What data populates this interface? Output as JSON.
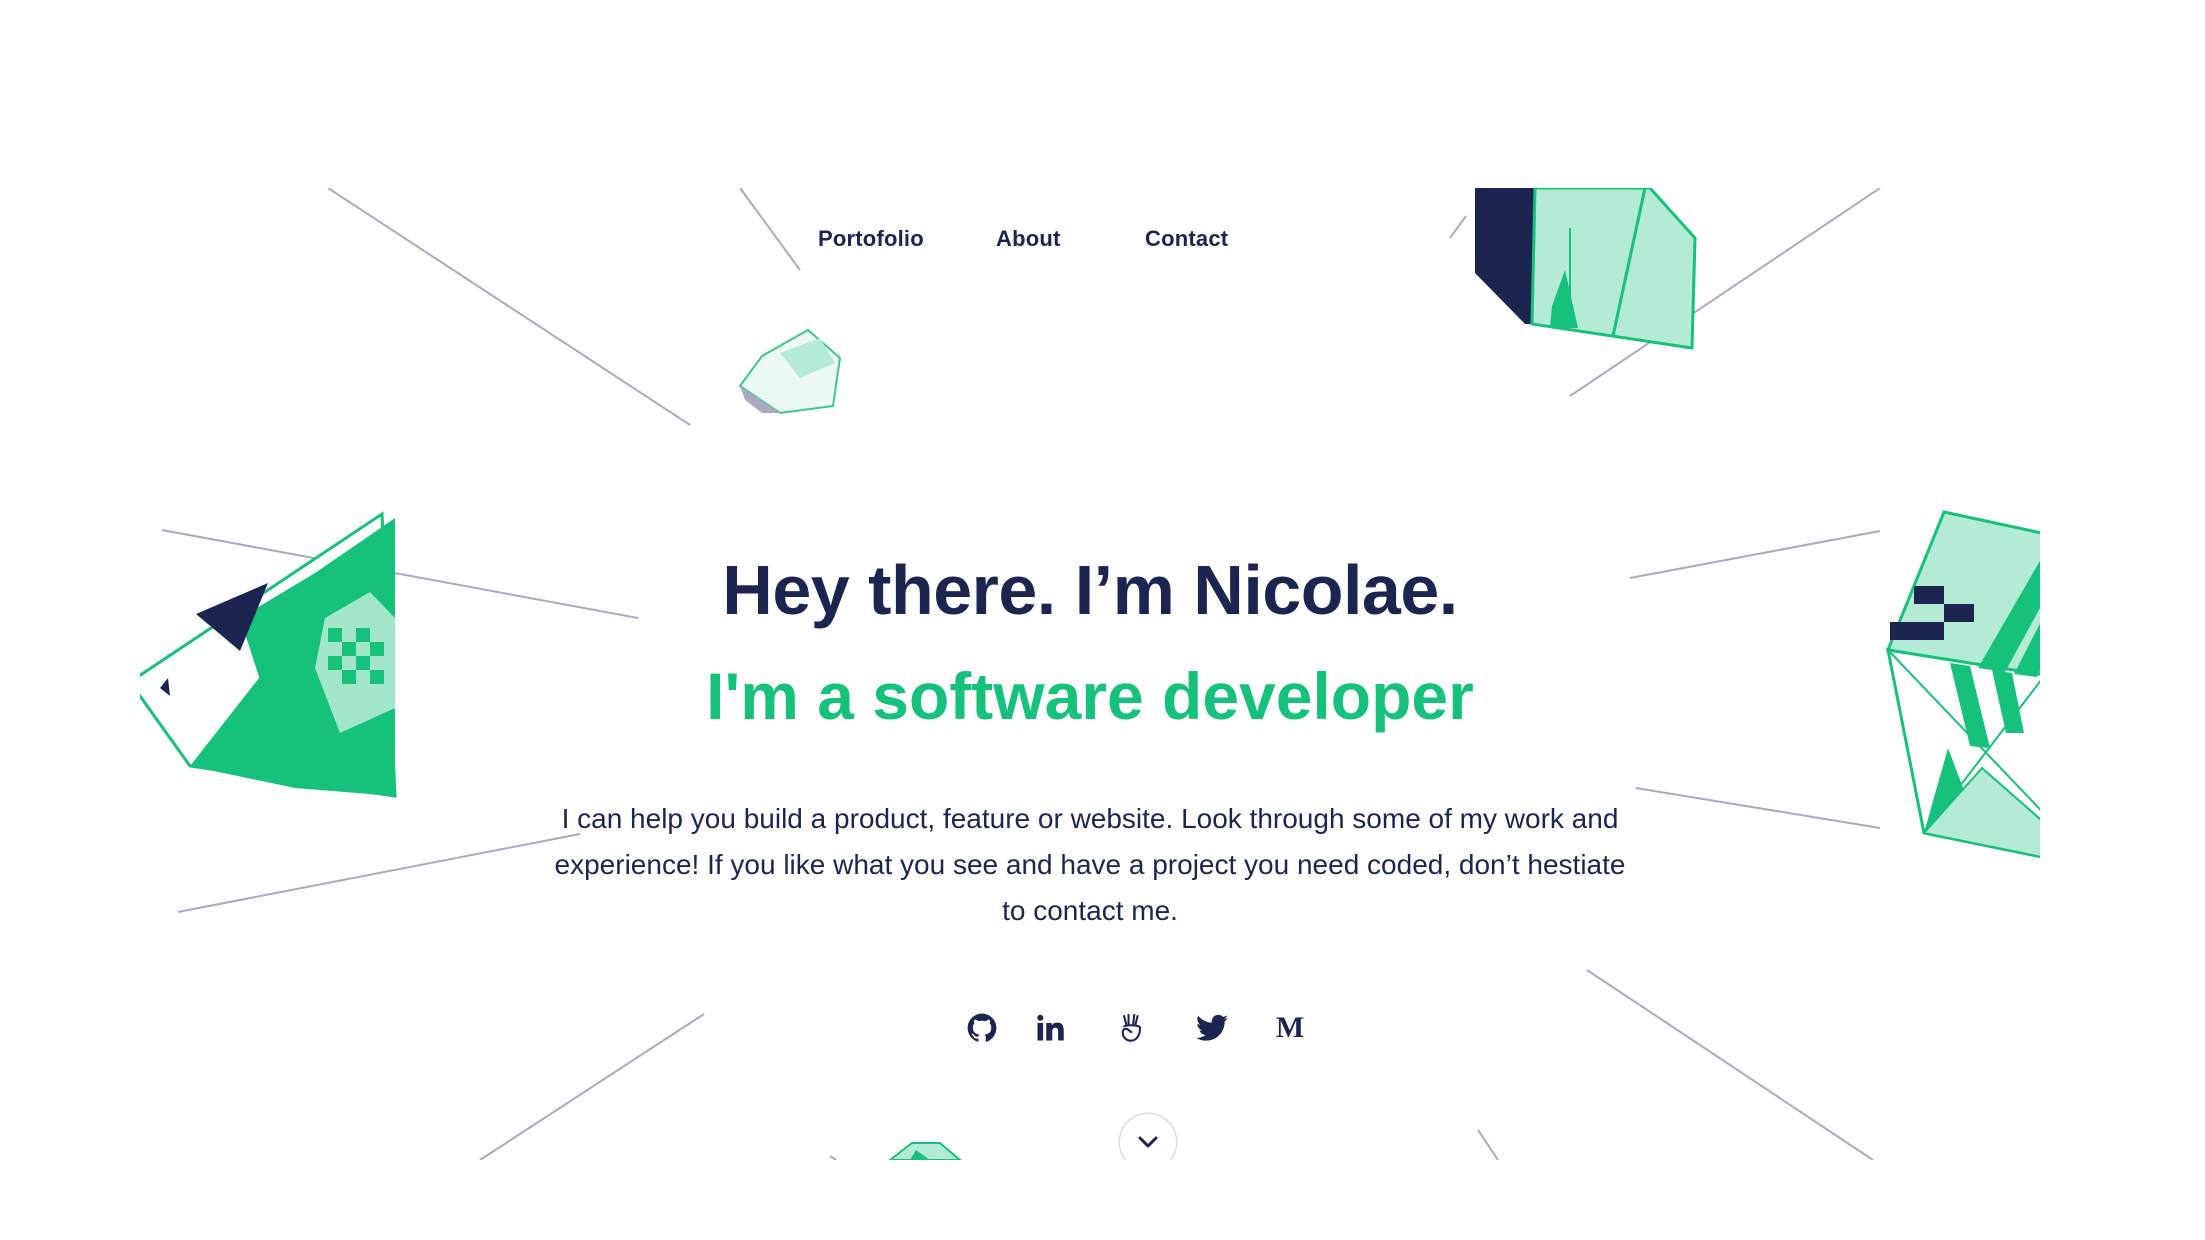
{
  "nav": {
    "items": [
      {
        "label": "Portofolio"
      },
      {
        "label": "About"
      },
      {
        "label": "Contact"
      }
    ]
  },
  "hero": {
    "headline": "Hey there. I’m Nicolae.",
    "subheadline": "I'm a software developer",
    "intro_lines": [
      "I can help you build a product, feature or website. Look through some of my work and",
      "experience! If you like what you see and have a project you need coded, don’t hestiate",
      "to contact me."
    ]
  },
  "social": [
    {
      "icon": "github-icon"
    },
    {
      "icon": "linkedin-icon"
    },
    {
      "icon": "angellist-icon"
    },
    {
      "icon": "twitter-icon"
    },
    {
      "icon": "medium-icon",
      "glyph": "M"
    }
  ],
  "scroll": {
    "icon": "chevron-down-icon"
  },
  "colors": {
    "navy": "#1b2550",
    "green": "#16c17b",
    "mint": "#b3ebd4",
    "line": "#a9aabf"
  }
}
